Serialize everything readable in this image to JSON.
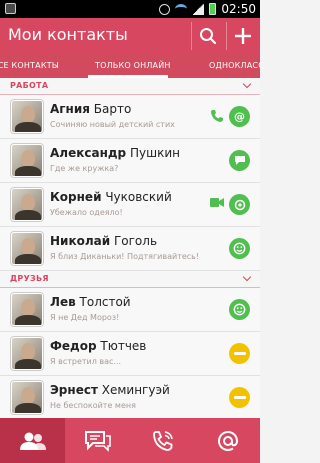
{
  "status_bar": {
    "time": "02:50"
  },
  "header": {
    "title": "Мои контакты",
    "search_icon": "search-icon",
    "add_icon": "plus-icon"
  },
  "tabs": [
    {
      "label": "ВСЕ КОНТАКТЫ"
    },
    {
      "label": "ТОЛЬКО ОНЛАЙН",
      "active": true
    },
    {
      "label": "ОДНОКЛАСС"
    }
  ],
  "sections": [
    {
      "label": "РАБОТА"
    },
    {
      "label": "ДРУЗЬЯ"
    }
  ],
  "contacts": [
    {
      "first": "Агния",
      "last": "Барто",
      "status": "Сочиняю новый детский стих",
      "badge_color": "green",
      "badge_icon": "at-icon",
      "side_icon": "phone-icon"
    },
    {
      "first": "Александр",
      "last": "Пушкин",
      "status": "Где же кружка?",
      "badge_color": "green",
      "badge_icon": "chat-icon"
    },
    {
      "first": "Корней",
      "last": "Чуковский",
      "status": "Убежало одеяло!",
      "badge_color": "green",
      "badge_icon": "whatsapp-icon",
      "side_icon": "video-icon"
    },
    {
      "first": "Николай",
      "last": "Гоголь",
      "status": "Я близ Диканьки! Подтягивайтесь!",
      "badge_color": "green",
      "badge_icon": "smile-icon"
    },
    {
      "first": "Лев",
      "last": "Толстой",
      "status": "Я не Дед Мороз!",
      "badge_color": "green",
      "badge_icon": "smile-icon"
    },
    {
      "first": "Федор",
      "last": "Тютчев",
      "status": "Я встретил вас...",
      "badge_color": "yellow",
      "badge_icon": "minus-icon"
    },
    {
      "first": "Эрнест",
      "last": "Хемингуэй",
      "status": "Не беспокойте меня",
      "badge_color": "yellow",
      "badge_icon": "minus-icon"
    }
  ],
  "bottom_nav": [
    {
      "icon": "contacts-icon",
      "active": true
    },
    {
      "icon": "chats-icon"
    },
    {
      "icon": "calls-icon"
    },
    {
      "icon": "at-icon"
    }
  ],
  "colors": {
    "accent": "#d84760",
    "online": "#4fbf4f",
    "away": "#f2c200"
  }
}
